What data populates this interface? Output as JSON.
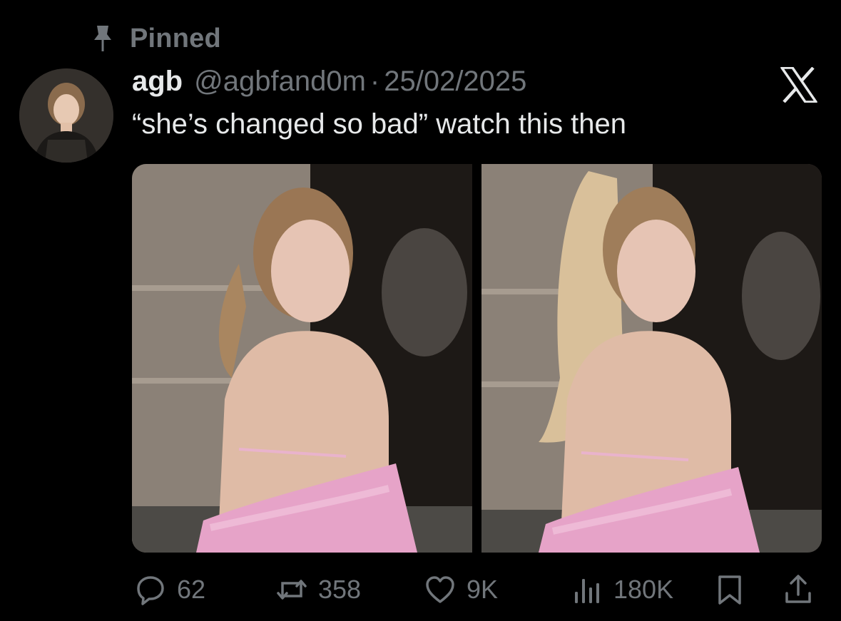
{
  "pinned": {
    "label": "Pinned",
    "icon": "pin-icon"
  },
  "author": {
    "display_name": "agb",
    "handle": "@agbfand0m",
    "separator": "·",
    "date": "25/02/2025",
    "avatar": "avatar"
  },
  "platform": {
    "logo": "x-logo-icon"
  },
  "tweet": {
    "text": "“she’s changed so bad” watch this then"
  },
  "media": [
    {
      "name": "photo-before"
    },
    {
      "name": "photo-after"
    }
  ],
  "actions": {
    "reply": {
      "icon": "reply-icon",
      "count": "62"
    },
    "repost": {
      "icon": "repost-icon",
      "count": "358"
    },
    "like": {
      "icon": "heart-icon",
      "count": "9K"
    },
    "views": {
      "icon": "views-icon",
      "count": "180K"
    },
    "bookmark": {
      "icon": "bookmark-icon"
    },
    "share": {
      "icon": "share-icon"
    }
  },
  "colors": {
    "background": "#000000",
    "text": "#e7e9ea",
    "muted": "#71767b"
  }
}
